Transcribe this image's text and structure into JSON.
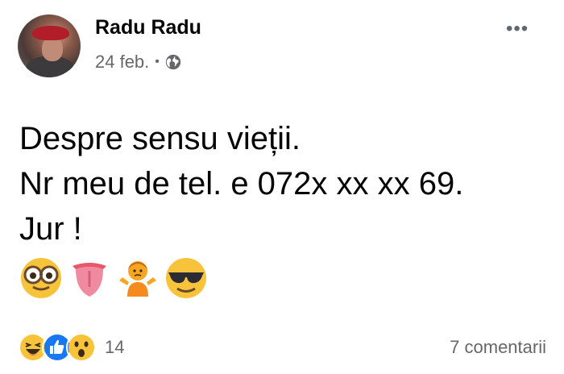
{
  "post": {
    "author": "Radu Radu",
    "date": "24 feb.",
    "separator": "•",
    "privacy_icon": "globe-icon",
    "more_icon": "more-options-icon",
    "more_label": "•••",
    "text_lines": [
      "Despre sensu vieții.",
      "Nr meu de tel. e 072x xx xx 69.",
      "Jur !"
    ],
    "emojis": [
      "nerd-glasses-face-emoji",
      "tongue-emoji",
      "person-shrugging-emoji",
      "smiling-face-sunglasses-emoji"
    ]
  },
  "footer": {
    "reactions": [
      "laugh-reaction-icon",
      "like-reaction-icon",
      "wow-reaction-icon"
    ],
    "reaction_count": "14",
    "comments_label": "7 comentarii"
  },
  "colors": {
    "like_blue": "#1877f2",
    "reaction_yellow": "#f7c33a",
    "meta_gray": "#65676b"
  }
}
